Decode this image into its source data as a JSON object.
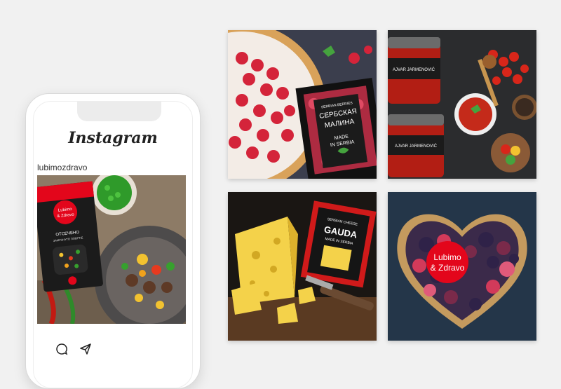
{
  "app": {
    "title": "Instagram"
  },
  "profile": {
    "username": "lubimozdravo"
  },
  "post": {
    "brand": [
      "Lubimo",
      "& Zdravo"
    ],
    "package_title": "ОТСЕЧЕНО",
    "package_sub": "ЗАМРЗНУТО ПОВРЋЕ"
  },
  "tiles": {
    "raspberry": {
      "line1": "SERBIAN BERRIES",
      "line2": "СЕРБСКАЯ",
      "line3": "МАЛИНА",
      "line4": "MADE",
      "line5": "IN SERBIA"
    },
    "ajvar": {
      "jar_top": "AJVAR JARMENOVIĆ",
      "jar_bottom": "AJVAR JARMENOVIĆ"
    },
    "cheese": {
      "brand": "SERBIAN CHEESE",
      "name": "GAUDA",
      "sub": "MADE IN SERBIA"
    },
    "berries": {
      "brand_line1": "Lubimo",
      "brand_line2": "& Zdravo"
    }
  },
  "icons": [
    "comment-icon",
    "share-icon"
  ],
  "colors": {
    "brand_red": "#e3061b",
    "background": "#f1f1f1"
  }
}
